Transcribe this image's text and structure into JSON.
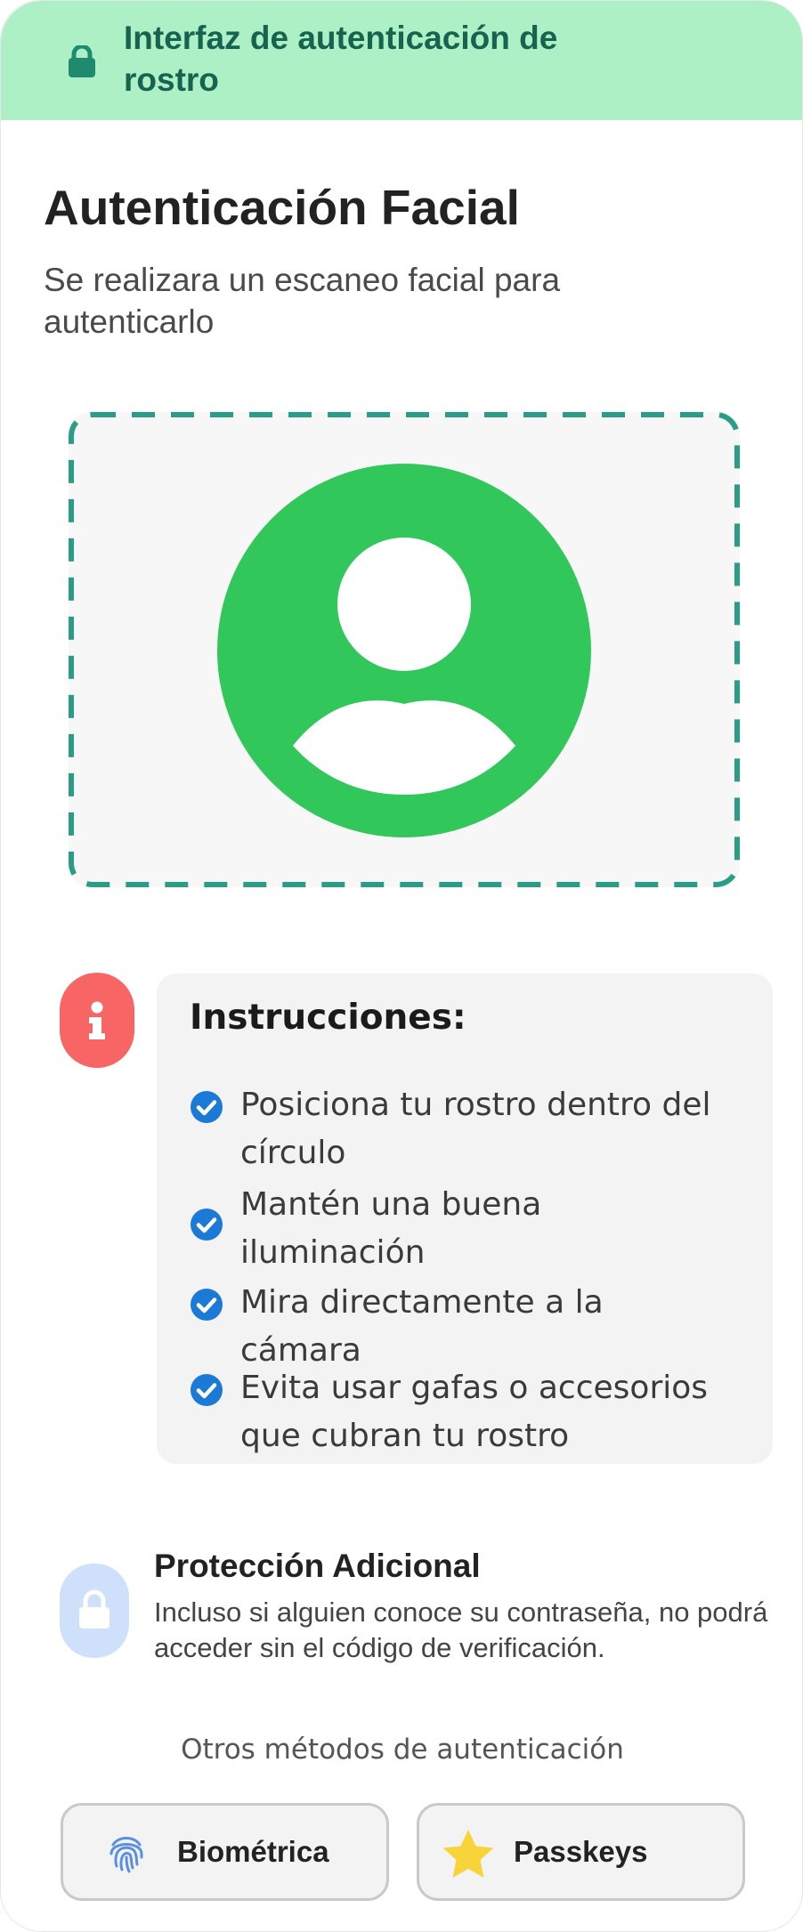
{
  "header": {
    "title": "Interfaz de autenticación de rostro",
    "lock_icon": "lock-icon"
  },
  "main": {
    "title": "Autenticación Facial",
    "subtitle": "Se realizara un escaneo facial para autenticarlo",
    "scan_icon": "user-avatar-icon"
  },
  "instructions": {
    "title": "Instrucciones:",
    "items": [
      "Posiciona tu rostro dentro del círculo",
      "Mantén una buena iluminación",
      "Mira directamente a la cámara",
      "Evita usar gafas o accesorios que cubran tu rostro"
    ]
  },
  "protection": {
    "title": "Protección Adicional",
    "text": "Incluso si alguien conoce su contraseña, no podrá acceder sin el código de verificación."
  },
  "other_methods": {
    "label": "Otros métodos de autenticación",
    "buttons": [
      {
        "label": "Biométrica",
        "icon": "fingerprint-icon"
      },
      {
        "label": "Passkeys",
        "icon": "star-icon"
      }
    ]
  },
  "colors": {
    "header_bg": "#aef0c6",
    "header_text": "#16644f",
    "scan_border": "#2a9d86",
    "avatar": "#31c75a",
    "info_badge": "#f76565",
    "check": "#1a7ad6",
    "protection_badge": "#cfe0fb"
  }
}
